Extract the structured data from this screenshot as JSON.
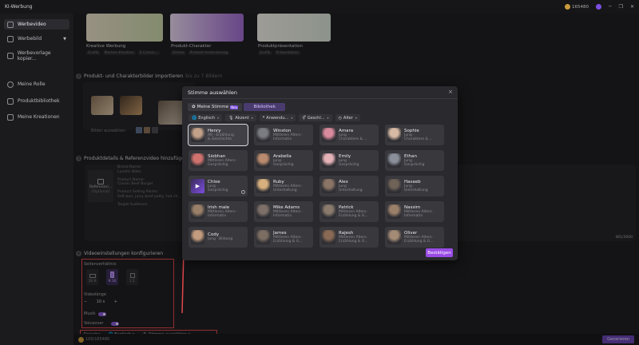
{
  "window": {
    "title": "KI-Werbung",
    "credits": "165480"
  },
  "sidebar": {
    "items": [
      {
        "label": "Werbevideo",
        "active": true
      },
      {
        "label": "Werbebild",
        "chevron": true
      },
      {
        "label": "Werbevorlage kopier..."
      },
      {
        "label": "Meine Rolle"
      },
      {
        "label": "Produktbibliothek"
      },
      {
        "label": "Meine Kreationen"
      }
    ]
  },
  "templates": [
    {
      "title": "Kreative Werbung",
      "tags": [
        "Grafik",
        "Marken-Kreation",
        "E-Comm..."
      ]
    },
    {
      "title": "Produkt-Charakter",
      "tags": [
        "Online",
        "Produkt-Inszenierung"
      ]
    },
    {
      "title": "Produktpräsentation",
      "tags": [
        "Grafik",
        "Präsentation"
      ]
    }
  ],
  "section2": {
    "num": "2",
    "title": "Produkt- und Charakterbilder importieren",
    "hint": "bis zu 7 Bildern",
    "more": "Bilder auswählen"
  },
  "section3": {
    "num": "3",
    "title": "Produktdetails & Referenzvideo hinzufügen",
    "ref_label": "Referenzvi...",
    "ref_sub": "(Optional)",
    "lines": [
      "Brand Name:",
      "Lunetic Bites",
      "",
      "Product Name:",
      "Classic Beef Burger",
      "",
      "Product Selling Points:",
      "Soft bun, juicy beef patty, hot ch...",
      "",
      "Target Audience:"
    ],
    "counter": "461/3000"
  },
  "section4": {
    "num": "4",
    "title": "Videoeinstellungen konfigurieren",
    "ratio_label": "Seitenverhältnis",
    "ratios": [
      "16:9",
      "9:16",
      "1:1"
    ],
    "length_label": "Videolänge",
    "length_value": "10 s",
    "music_label": "Musik",
    "voice_label": "Voiceover"
  },
  "bottom_bar": {
    "language_label": "Sprache",
    "language": "Englisch",
    "voice_select": "Stimme auswählen",
    "credits": "100/165480",
    "generate": "Generieren"
  },
  "modal": {
    "title": "Stimme auswählen",
    "tabs": {
      "mine": "Meine Stimme",
      "mine_badge": "Neu",
      "library": "Bibliothek"
    },
    "filters": [
      {
        "icon": "🌐",
        "label": "Englisch"
      },
      {
        "icon": "🎙",
        "label": "Akzent"
      },
      {
        "icon": "❝",
        "label": "Anwendu..."
      },
      {
        "icon": "⚥",
        "label": "Geschl..."
      },
      {
        "icon": "◷",
        "label": "Alter"
      }
    ],
    "voices": [
      {
        "name": "Henry",
        "desc1": "Alt · Erzählung",
        "desc2": "& Geschichte",
        "selected": true,
        "color": "#c2a089"
      },
      {
        "name": "Winston",
        "desc1": "Mittleren Alters ·",
        "desc2": "Informativ",
        "color": "#7b7c82"
      },
      {
        "name": "Amara",
        "desc1": "Jung ·",
        "desc2": "Charaktere & ...",
        "color": "#d98a9d"
      },
      {
        "name": "Sophie",
        "desc1": "Jung ·",
        "desc2": "Charaktere & ...",
        "color": "#d7b9a4"
      },
      {
        "name": "Siobhan",
        "desc1": "Mittleren Alters ·",
        "desc2": "Gesprächig",
        "color": "#d0736f"
      },
      {
        "name": "Arabella",
        "desc1": "Jung ·",
        "desc2": "Gesprächig",
        "color": "#b98a6e"
      },
      {
        "name": "Emily",
        "desc1": "Jung ·",
        "desc2": "Gesprächig",
        "color": "#e4b2b7"
      },
      {
        "name": "Ethan",
        "desc1": "Jung ·",
        "desc2": "Gesprächig",
        "color": "#8a8f9a"
      },
      {
        "name": "Chloe",
        "desc1": "Jung ·",
        "desc2": "Gesprächig",
        "playing": true,
        "color": "#5a3f86"
      },
      {
        "name": "Ruby",
        "desc1": "Mittleren Alters ·",
        "desc2": "Unterhaltung",
        "color": "#d8b07e"
      },
      {
        "name": "Alex",
        "desc1": "Jung ·",
        "desc2": "Unterhaltung",
        "color": "#8b7566"
      },
      {
        "name": "Hasaeb",
        "desc1": "Jung ·",
        "desc2": "Unterhaltung",
        "color": "#6f6257"
      },
      {
        "name": "Irish male",
        "desc1": "Mittleren Alters ·",
        "desc2": "Informativ",
        "color": "#9a8069"
      },
      {
        "name": "Mike Adams",
        "desc1": "Mittleren Alters ·",
        "desc2": "Informativ",
        "color": "#7d7068"
      },
      {
        "name": "Patrick",
        "desc1": "Mittleren Alters ·",
        "desc2": "Erzählung & G...",
        "color": "#8a7b6d"
      },
      {
        "name": "Nassim",
        "desc1": "Mittleren Alters ·",
        "desc2": "Informativ",
        "color": "#9a7f69"
      },
      {
        "name": "Cody",
        "desc1": "Jung · Bildung",
        "desc2": "",
        "color": "#c39b7f"
      },
      {
        "name": "James",
        "desc1": "Mittleren Alters ·",
        "desc2": "Erzählung & G...",
        "color": "#7c6e62"
      },
      {
        "name": "Rajesh",
        "desc1": "Mittleren Alters ·",
        "desc2": "Erzählung & G...",
        "color": "#8a6a55"
      },
      {
        "name": "Oliver",
        "desc1": "Mittleren Alters ·",
        "desc2": "Erzählung & G...",
        "color": "#a48b76"
      }
    ],
    "confirm": "Bestätigen"
  }
}
